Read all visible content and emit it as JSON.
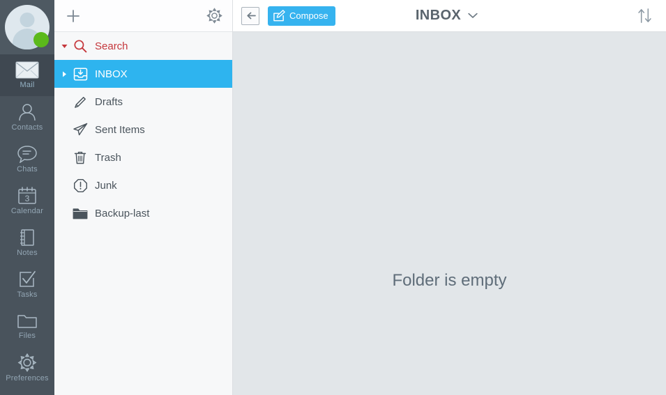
{
  "rail": {
    "avatar": {
      "icon": "user-avatar",
      "presence_status": "online",
      "presence_color": "#5bb91b"
    },
    "items": [
      {
        "label": "Mail",
        "icon": "envelope-icon",
        "active": true
      },
      {
        "label": "Contacts",
        "icon": "person-icon",
        "active": false
      },
      {
        "label": "Chats",
        "icon": "chat-bubble-icon",
        "active": false
      },
      {
        "label": "Calendar",
        "icon": "calendar-icon",
        "active": false
      },
      {
        "label": "Notes",
        "icon": "notebook-icon",
        "active": false
      },
      {
        "label": "Tasks",
        "icon": "checkbox-icon",
        "active": false
      },
      {
        "label": "Files",
        "icon": "folder-icon",
        "active": false
      },
      {
        "label": "Preferences",
        "icon": "gear-icon",
        "active": false
      }
    ]
  },
  "folders": {
    "toolbar": {
      "add_label": "+",
      "add_icon": "plus-icon",
      "settings_icon": "gear-icon"
    },
    "rows": [
      {
        "label": "Search",
        "icon": "magnifier-icon",
        "twisty": "down",
        "selected": false,
        "kind": "search"
      },
      {
        "label": "INBOX",
        "icon": "inbox-tray-icon",
        "twisty": "right",
        "selected": true,
        "kind": "folder"
      },
      {
        "label": "Drafts",
        "icon": "pencil-icon",
        "twisty": "",
        "selected": false,
        "kind": "folder"
      },
      {
        "label": "Sent Items",
        "icon": "paper-plane-icon",
        "twisty": "",
        "selected": false,
        "kind": "folder"
      },
      {
        "label": "Trash",
        "icon": "trash-can-icon",
        "twisty": "",
        "selected": false,
        "kind": "folder"
      },
      {
        "label": "Junk",
        "icon": "exclamation-octagon-icon",
        "twisty": "",
        "selected": false,
        "kind": "folder"
      },
      {
        "label": "Backup-last",
        "icon": "folder-filled-icon",
        "twisty": "",
        "selected": false,
        "kind": "folder"
      }
    ]
  },
  "messages": {
    "toolbar": {
      "collapse_icon": "collapse-left-icon",
      "compose_label": "Compose",
      "compose_icon": "compose-pencil-icon",
      "folder_title": "INBOX",
      "folder_title_chevron": "chevron-down-icon",
      "sort_icon": "sort-arrows-icon"
    },
    "empty_state": "Folder is empty"
  },
  "colors": {
    "accent": "#2eb4ef",
    "rail_bg": "#49535c",
    "rail_active": "#3f4851",
    "folder_pane_bg": "#f7f8f9",
    "message_pane_bg": "#e2e6e9",
    "search_red": "#c5373c",
    "presence_green": "#5bb91b"
  }
}
